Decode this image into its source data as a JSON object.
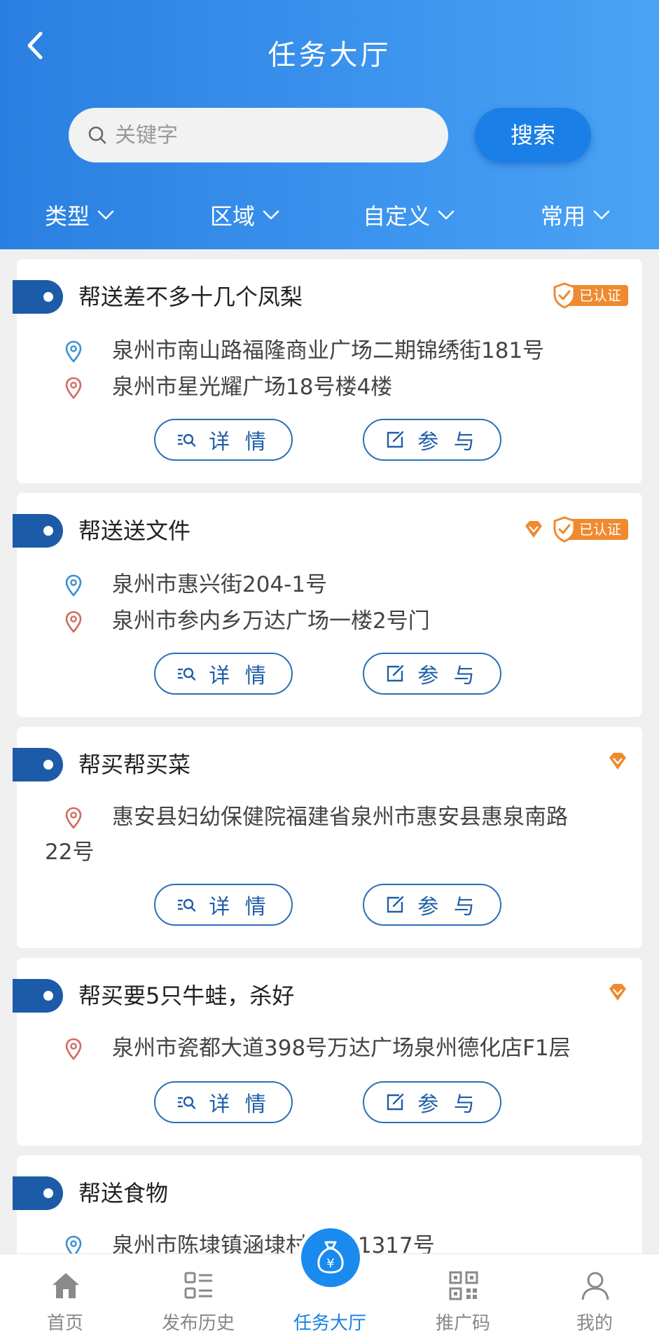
{
  "header": {
    "title": "任务大厅",
    "search_placeholder": "关键字",
    "search_button": "搜索",
    "filters": [
      "类型",
      "区域",
      "自定义",
      "常用"
    ]
  },
  "colors": {
    "primary": "#1a7fe6",
    "tag": "#1c5ba8",
    "badge_orange": "#ef8a2f",
    "pickup_pin": "#3a8fd0",
    "dropoff_pin": "#d26a5f"
  },
  "tasks": [
    {
      "title": "帮送差不多十几个凤梨",
      "verified_label": "已认证",
      "from": "泉州市南山路福隆商业广场二期锦绣街181号",
      "to": "泉州市星光耀广场18号楼4楼",
      "detail_label": "详 情",
      "join_label": "参 与"
    },
    {
      "title": "帮送送文件",
      "verified_label": "已认证",
      "from": "泉州市惠兴街204-1号",
      "to": "泉州市参内乡万达广场一楼2号门",
      "detail_label": "详 情",
      "join_label": "参 与"
    },
    {
      "title": "帮买帮买菜",
      "to_line1": "惠安县妇幼保健院福建省泉州市惠安县惠泉南路",
      "to_line2": "22号",
      "detail_label": "详 情",
      "join_label": "参 与"
    },
    {
      "title": "帮买要5只牛蛙，杀好",
      "to": "泉州市瓷都大道398号万达广场泉州德化店F1层",
      "detail_label": "详 情",
      "join_label": "参 与"
    },
    {
      "title": "帮送食物",
      "from": "泉州市陈埭镇涵埭村  中路1317号"
    }
  ],
  "nav": {
    "items": [
      "首页",
      "发布历史",
      "任务大厅",
      "推广码",
      "我的"
    ],
    "active": "任务大厅"
  }
}
